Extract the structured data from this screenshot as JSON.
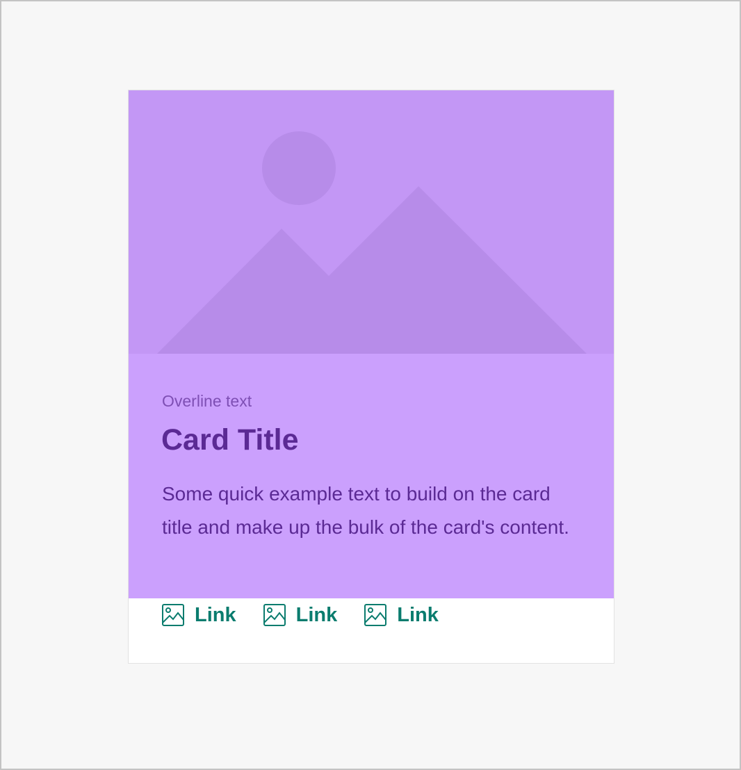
{
  "colors": {
    "page_background": "#f7f7f7",
    "media_background": "#c397f5",
    "media_placeholder_shape": "#b78ce9",
    "content_background": "#cba0fd",
    "overline_text": "#7e4fb4",
    "title_text": "#5b2a94",
    "link_color": "#0a7c6e"
  },
  "card": {
    "media_icon": "image-placeholder-icon",
    "overline": "Overline text",
    "title": "Card Title",
    "body": "Some quick example text to build on the card title and make up the bulk of the card's content.",
    "actions": [
      {
        "icon": "image-icon",
        "label": "Link"
      },
      {
        "icon": "image-icon",
        "label": "Link"
      },
      {
        "icon": "image-icon",
        "label": "Link"
      }
    ]
  }
}
